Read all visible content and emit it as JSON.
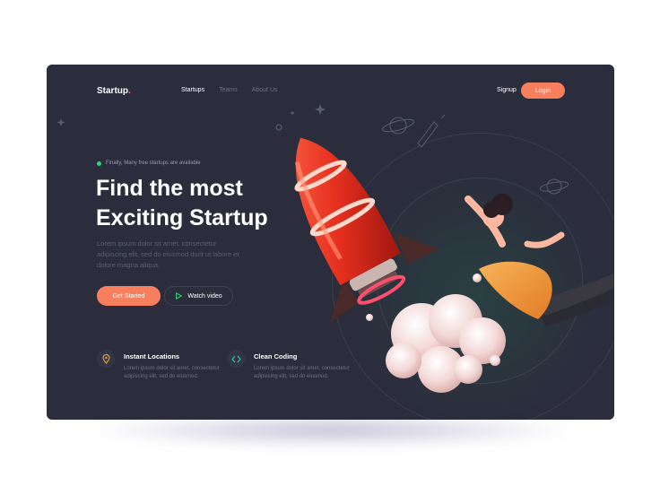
{
  "brand": {
    "name": "Startup",
    "dot": "."
  },
  "nav": {
    "items": [
      "Startups",
      "Teams",
      "About Us"
    ],
    "active": "Startups"
  },
  "auth": {
    "signup": "Signup",
    "login": "Login"
  },
  "hero": {
    "availability": "Finally, Many free startups are available",
    "headline_line1": "Find the most",
    "headline_line2": "Exciting Startup",
    "body": "Lorem ipsum dolor sit amet, consectetur adipiscing elit, sed do eiusmod durit ut labore et dolore magna aliqua.",
    "cta_primary": "Get Started",
    "cta_secondary": "Watch video"
  },
  "features": [
    {
      "title": "Instant Locations",
      "description": "Lorem ipsum dolor sit amet, consectetur adipiscing elit, sed do eiusmod.",
      "icon": "location-pin-icon"
    },
    {
      "title": "Clean Coding",
      "description": "Lorem ipsum dolor sit amet, consectetur adipiscing elit, sed do eiusmod.",
      "icon": "code-brackets-icon"
    }
  ],
  "colors": {
    "accent": "#f77f5e",
    "background": "#2b2d3c",
    "status_green": "#33d17a",
    "code_green": "#2ec4a0"
  }
}
